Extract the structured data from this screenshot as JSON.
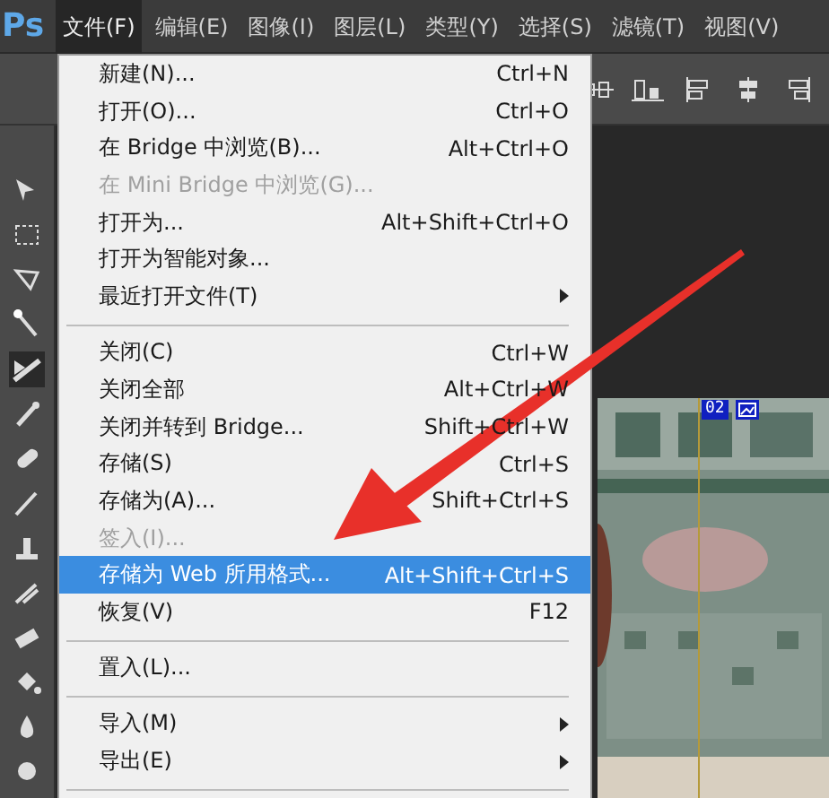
{
  "app": {
    "logo": "Ps"
  },
  "menubar": [
    {
      "label": "文件(F)",
      "selected": true
    },
    {
      "label": "编辑(E)",
      "selected": false
    },
    {
      "label": "图像(I)",
      "selected": false
    },
    {
      "label": "图层(L)",
      "selected": false
    },
    {
      "label": "类型(Y)",
      "selected": false
    },
    {
      "label": "选择(S)",
      "selected": false
    },
    {
      "label": "滤镜(T)",
      "selected": false
    },
    {
      "label": "视图(V)",
      "selected": false
    }
  ],
  "file_menu": [
    {
      "kind": "item",
      "label": "新建(N)...",
      "shortcut": "Ctrl+N",
      "disabled": false,
      "selected": false
    },
    {
      "kind": "item",
      "label": "打开(O)...",
      "shortcut": "Ctrl+O",
      "disabled": false,
      "selected": false
    },
    {
      "kind": "item",
      "label": "在 Bridge 中浏览(B)...",
      "shortcut": "Alt+Ctrl+O",
      "disabled": false,
      "selected": false
    },
    {
      "kind": "item",
      "label": "在 Mini Bridge 中浏览(G)...",
      "disabled": true,
      "selected": false
    },
    {
      "kind": "item",
      "label": "打开为...",
      "shortcut": "Alt+Shift+Ctrl+O",
      "disabled": false,
      "selected": false
    },
    {
      "kind": "item",
      "label": "打开为智能对象...",
      "disabled": false,
      "selected": false
    },
    {
      "kind": "submenu",
      "label": "最近打开文件(T)",
      "disabled": false,
      "selected": false
    },
    {
      "kind": "separator"
    },
    {
      "kind": "item",
      "label": "关闭(C)",
      "shortcut": "Ctrl+W",
      "disabled": false,
      "selected": false
    },
    {
      "kind": "item",
      "label": "关闭全部",
      "shortcut": "Alt+Ctrl+W",
      "disabled": false,
      "selected": false
    },
    {
      "kind": "item",
      "label": "关闭并转到 Bridge...",
      "shortcut": "Shift+Ctrl+W",
      "disabled": false,
      "selected": false
    },
    {
      "kind": "item",
      "label": "存储(S)",
      "shortcut": "Ctrl+S",
      "disabled": false,
      "selected": false
    },
    {
      "kind": "item",
      "label": "存储为(A)...",
      "shortcut": "Shift+Ctrl+S",
      "disabled": false,
      "selected": false
    },
    {
      "kind": "item",
      "label": "签入(I)...",
      "disabled": true,
      "selected": false
    },
    {
      "kind": "item",
      "label": "存储为 Web 所用格式...",
      "shortcut": "Alt+Shift+Ctrl+S",
      "disabled": false,
      "selected": true
    },
    {
      "kind": "item",
      "label": "恢复(V)",
      "shortcut": "F12",
      "disabled": false,
      "selected": false
    },
    {
      "kind": "separator"
    },
    {
      "kind": "item",
      "label": "置入(L)...",
      "disabled": false,
      "selected": false
    },
    {
      "kind": "separator"
    },
    {
      "kind": "submenu",
      "label": "导入(M)",
      "disabled": false,
      "selected": false
    },
    {
      "kind": "submenu",
      "label": "导出(E)",
      "disabled": false,
      "selected": false
    },
    {
      "kind": "separator"
    }
  ],
  "canvas": {
    "slice_number": "02"
  }
}
